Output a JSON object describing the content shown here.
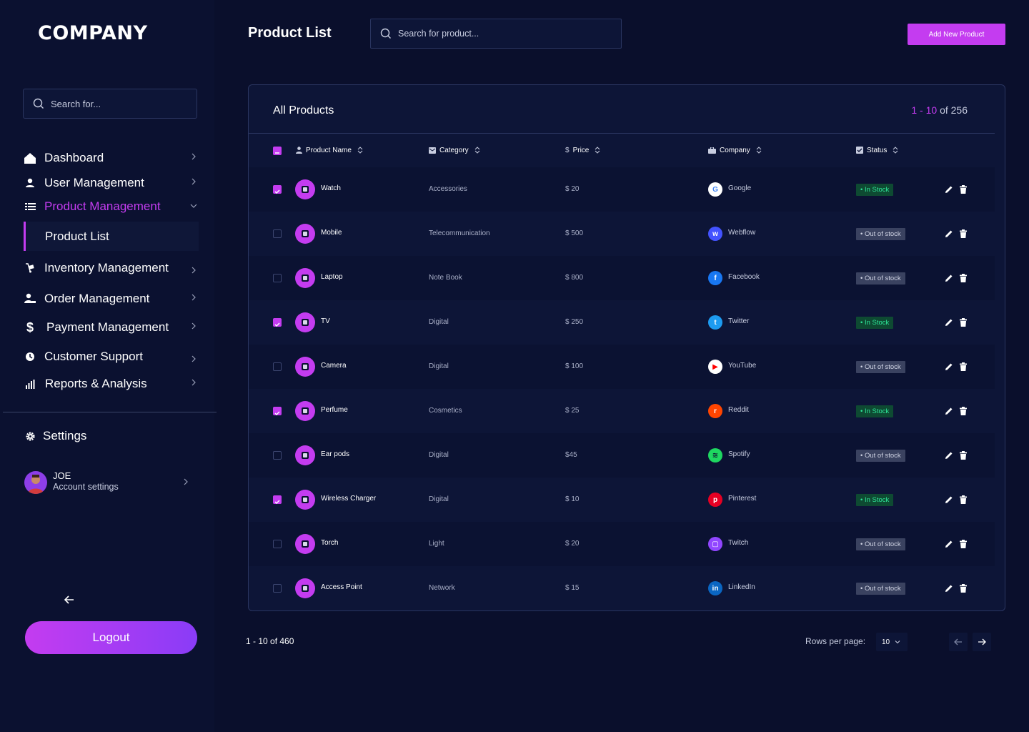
{
  "brand": {
    "logo_text": "COMPANY",
    "accent": "#c43cf0",
    "bg": "#0a0f2c"
  },
  "sidebar": {
    "search_placeholder": "Search for...",
    "items": [
      {
        "label": "Dashboard",
        "icon": "home-icon"
      },
      {
        "label": "User Management",
        "icon": "user-icon"
      },
      {
        "label": "Product Management",
        "icon": "product-list-icon",
        "active": true
      },
      {
        "label": "Inventory Management",
        "icon": "dolly-icon"
      },
      {
        "label": "Order Management",
        "icon": "order-user-icon"
      },
      {
        "label": "Payment Management",
        "icon": "dollar-icon"
      },
      {
        "label": "Customer Support",
        "icon": "support-icon"
      },
      {
        "label": "Reports & Analysis",
        "icon": "bar-chart-icon"
      }
    ],
    "sub_item": "Product List",
    "settings_label": "Settings",
    "user": {
      "name": "JOE",
      "subtitle": "Account settings"
    },
    "logout_label": "Logout"
  },
  "header": {
    "title": "Product List",
    "search_placeholder": "Search for product...",
    "add_button": "Add New Product"
  },
  "panel": {
    "title": "All Products",
    "count_range": "1 - 10",
    "count_total": "of 256",
    "columns": [
      "Product Name",
      "Category",
      "Price",
      "Company",
      "Status"
    ],
    "rows": [
      {
        "checked": true,
        "name": "Watch",
        "category": "Accessories",
        "price": "$ 20",
        "company": "Google",
        "company_color": "#ffffff",
        "company_glyph": "G",
        "glyph_color": "#4285f4",
        "status": "• In Stock",
        "in_stock": true
      },
      {
        "checked": false,
        "name": "Mobile",
        "category": "Telecommunication",
        "price": "$ 500",
        "company": "Webflow",
        "company_color": "#4353ff",
        "company_glyph": "w",
        "glyph_color": "#ffffff",
        "status": "• Out of stock",
        "in_stock": false
      },
      {
        "checked": false,
        "name": "Laptop",
        "category": "Note Book",
        "price": "$ 800",
        "company": "Facebook",
        "company_color": "#1877f2",
        "company_glyph": "f",
        "glyph_color": "#ffffff",
        "status": "• Out of stock",
        "in_stock": false
      },
      {
        "checked": true,
        "name": "TV",
        "category": "Digital",
        "price": "$ 250",
        "company": "Twitter",
        "company_color": "#1d9bf0",
        "company_glyph": "t",
        "glyph_color": "#ffffff",
        "status": "• In Stock",
        "in_stock": true
      },
      {
        "checked": false,
        "name": "Camera",
        "category": "Digital",
        "price": "$ 100",
        "company": "YouTube",
        "company_color": "#ffffff",
        "company_glyph": "▶",
        "glyph_color": "#ff0000",
        "status": "• Out of stock",
        "in_stock": false
      },
      {
        "checked": true,
        "name": "Perfume",
        "category": "Cosmetics",
        "price": "$ 25",
        "company": "Reddit",
        "company_color": "#ff4500",
        "company_glyph": "r",
        "glyph_color": "#ffffff",
        "status": "• In Stock",
        "in_stock": true
      },
      {
        "checked": false,
        "name": "Ear pods",
        "category": "Digital",
        "price": "$45",
        "company": "Spotify",
        "company_color": "#1ed760",
        "company_glyph": "≋",
        "glyph_color": "#0b1130",
        "status": "• Out of stock",
        "in_stock": false
      },
      {
        "checked": true,
        "name": "Wireless Charger",
        "category": "Digital",
        "price": "$ 10",
        "company": "Pinterest",
        "company_color": "#e60023",
        "company_glyph": "p",
        "glyph_color": "#ffffff",
        "status": "• In Stock",
        "in_stock": true
      },
      {
        "checked": false,
        "name": "Torch",
        "category": "Light",
        "price": "$ 20",
        "company": "Twitch",
        "company_color": "#9146ff",
        "company_glyph": "▢",
        "glyph_color": "#ffffff",
        "status": "• Out of stock",
        "in_stock": false
      },
      {
        "checked": false,
        "name": "Access Point",
        "category": "Network",
        "price": "$ 15",
        "company": "LinkedIn",
        "company_color": "#0a66c2",
        "company_glyph": "in",
        "glyph_color": "#ffffff",
        "status": "• Out of stock",
        "in_stock": false
      }
    ]
  },
  "footer": {
    "count": "1 - 10 of 460",
    "rows_per_page_label": "Rows per page:",
    "rows_per_page_value": "10"
  }
}
